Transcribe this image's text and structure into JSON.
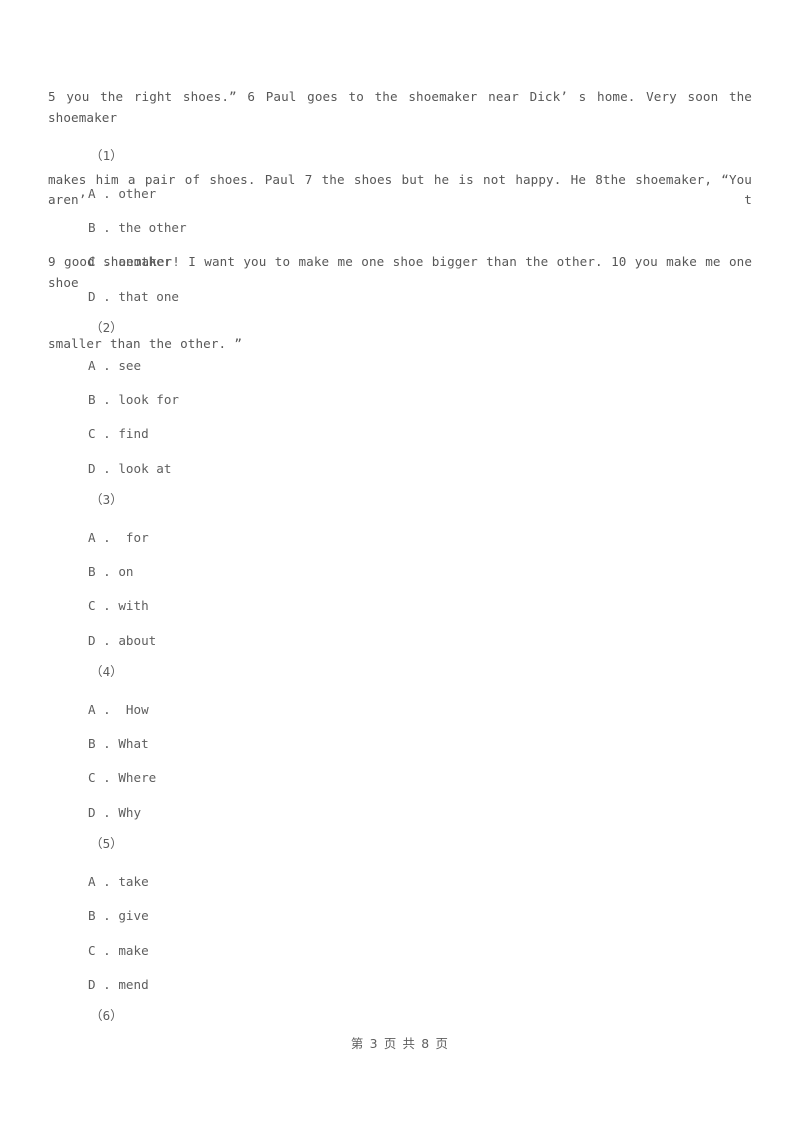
{
  "document": {
    "passage": {
      "lines": [
        "5 you the right shoes.” 6 Paul goes to the shoemaker near Dick’ s home. Very soon the shoemaker",
        "makes him a pair of shoes. Paul 7 the shoes but he is not happy. He 8the shoemaker, “You aren’ t",
        "9 good shoemaker! I want you to make me one shoe bigger than the other. 10 you make me one shoe",
        "smaller than the other. ”"
      ]
    },
    "questions": [
      {
        "number": "（1）",
        "options": [
          "A . other",
          "B . the other",
          "C . another",
          "D . that one"
        ]
      },
      {
        "number": "（2）",
        "options": [
          "A . see",
          "B . look for",
          "C . find",
          "D . look at"
        ]
      },
      {
        "number": "（3）",
        "options": [
          "A .  for",
          "B . on",
          "C . with",
          "D . about"
        ]
      },
      {
        "number": "（4）",
        "options": [
          "A .  How",
          "B . What",
          "C . Where",
          "D . Why"
        ]
      },
      {
        "number": "（5）",
        "options": [
          "A . take",
          "B . give",
          "C . make",
          "D . mend"
        ]
      },
      {
        "number": "（6）",
        "options": []
      }
    ],
    "footer": {
      "text": "第 3 页 共 8 页",
      "current_page": "3",
      "total_pages": "8"
    },
    "colors": {
      "text": "#5a5a5a",
      "background": "#ffffff"
    }
  }
}
